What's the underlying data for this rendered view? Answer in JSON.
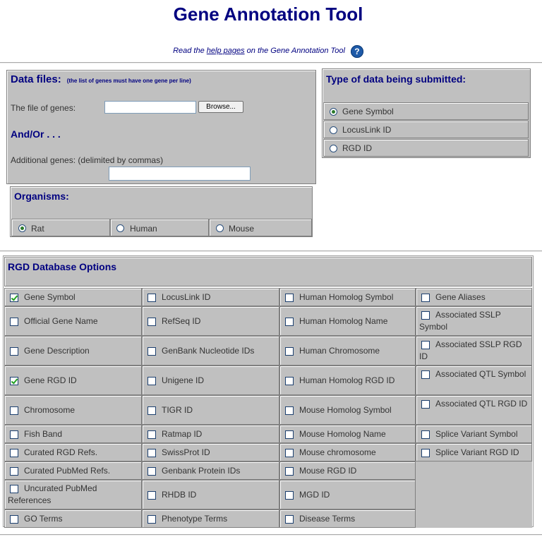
{
  "header": {
    "title": "Gene Annotation Tool",
    "help_prefix": "Read the ",
    "help_link": "help pages",
    "help_suffix": " on the Gene Annotation Tool",
    "help_icon": "?"
  },
  "data_files": {
    "heading": "Data files:",
    "note": "(the list of genes must have one gene per line)",
    "file_label": "The file of genes:",
    "file_value": "",
    "browse_label": "Browse...",
    "andor": "And/Or . . .",
    "additional_label": "Additional genes: (delimited by commas)",
    "additional_value": ""
  },
  "organisms": {
    "heading": "Organisms:",
    "options": [
      {
        "label": "Rat",
        "selected": true
      },
      {
        "label": "Human",
        "selected": false
      },
      {
        "label": "Mouse",
        "selected": false
      }
    ]
  },
  "data_type": {
    "heading": "Type of data being submitted:",
    "options": [
      {
        "label": "Gene Symbol",
        "selected": true
      },
      {
        "label": "LocusLink ID",
        "selected": false
      },
      {
        "label": "RGD ID",
        "selected": false
      }
    ]
  },
  "rgd_options": {
    "heading": "RGD Database Options",
    "columns": [
      [
        {
          "label": "Gene Symbol",
          "checked": true
        },
        {
          "label": "Official Gene Name",
          "checked": false
        },
        {
          "label": "Gene Description",
          "checked": false
        },
        {
          "label": "Gene RGD ID",
          "checked": true
        },
        {
          "label": "Chromosome",
          "checked": false
        },
        {
          "label": "Fish Band",
          "checked": false
        },
        {
          "label": "Curated RGD Refs.",
          "checked": false
        },
        {
          "label": "Curated PubMed Refs.",
          "checked": false
        },
        {
          "label": "Uncurated PubMed References",
          "checked": false
        },
        {
          "label": "GO Terms",
          "checked": false
        }
      ],
      [
        {
          "label": "LocusLink ID",
          "checked": false
        },
        {
          "label": "RefSeq ID",
          "checked": false
        },
        {
          "label": "GenBank Nucleotide IDs",
          "checked": false
        },
        {
          "label": "Unigene ID",
          "checked": false
        },
        {
          "label": "TIGR ID",
          "checked": false
        },
        {
          "label": "Ratmap ID",
          "checked": false
        },
        {
          "label": "SwissProt ID",
          "checked": false
        },
        {
          "label": "Genbank Protein IDs",
          "checked": false
        },
        {
          "label": "RHDB ID",
          "checked": false
        },
        {
          "label": "Phenotype Terms",
          "checked": false
        }
      ],
      [
        {
          "label": "Human Homolog Symbol",
          "checked": false
        },
        {
          "label": "Human Homolog Name",
          "checked": false
        },
        {
          "label": "Human Chromosome",
          "checked": false
        },
        {
          "label": "Human Homolog RGD ID",
          "checked": false
        },
        {
          "label": "Mouse Homolog Symbol",
          "checked": false
        },
        {
          "label": "Mouse Homolog Name",
          "checked": false
        },
        {
          "label": "Mouse chromosome",
          "checked": false
        },
        {
          "label": "Mouse RGD ID",
          "checked": false
        },
        {
          "label": "MGD ID",
          "checked": false
        },
        {
          "label": "Disease Terms",
          "checked": false
        }
      ],
      [
        {
          "label": "Gene Aliases",
          "checked": false
        },
        {
          "label": "Associated SSLP Symbol",
          "checked": false
        },
        {
          "label": "Associated SSLP RGD ID",
          "checked": false
        },
        {
          "label": "Associated QTL Symbol",
          "checked": false
        },
        {
          "label": "Associated QTL RGD ID",
          "checked": false
        },
        {
          "label": "Splice Variant Symbol",
          "checked": false
        },
        {
          "label": "Splice Variant RGD ID",
          "checked": false
        }
      ]
    ]
  }
}
